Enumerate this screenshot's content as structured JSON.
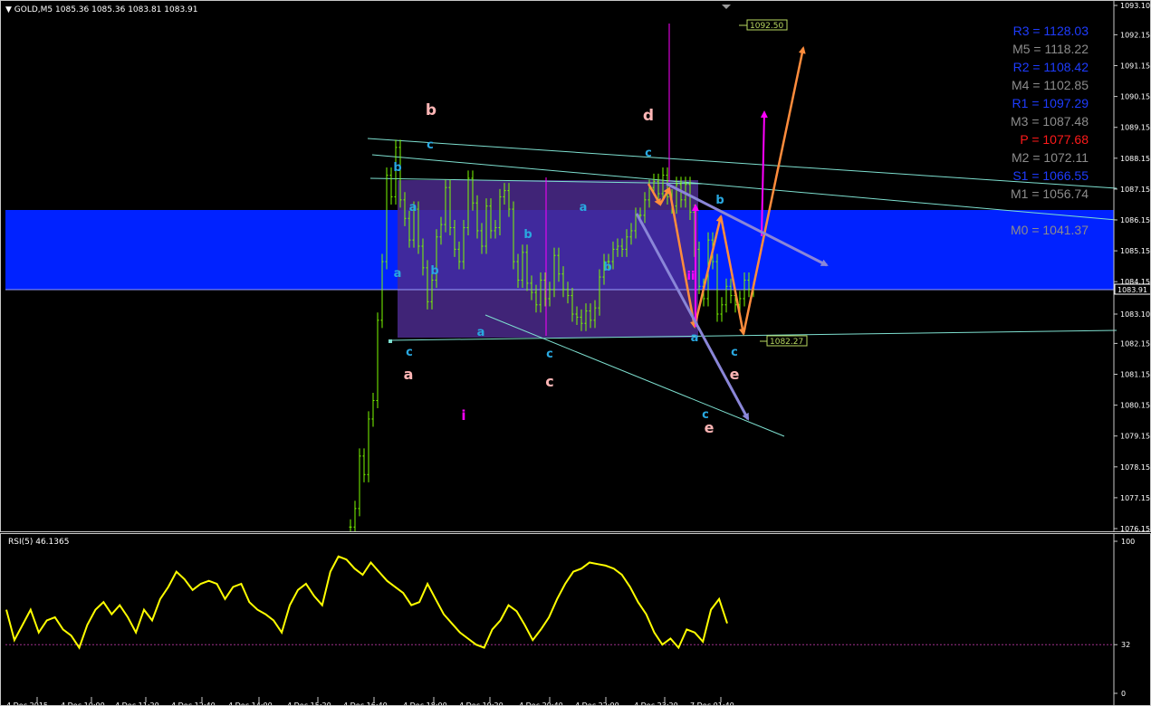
{
  "header": {
    "symbol": "GOLD,M5",
    "ohlc": "1085.36 1085.36 1083.81 1083.91",
    "rsi_label": "RSI(5) 46.1365"
  },
  "colors": {
    "candle": "#7cfc00",
    "zone": "#0022ff",
    "rect": "#4b2a8c",
    "rsi": "#ffff00",
    "wave_cyan": "#29a8e0",
    "wave_pink": "#ffb6b6",
    "magenta": "#ff00ff",
    "orange": "#ff8c3c",
    "lavender": "#8a86d8",
    "trend": "#7ee0d0"
  },
  "price_labels": {
    "upper_box": "1092.50",
    "lower_box": "1082.27",
    "current": "1083.91"
  },
  "pivots": [
    {
      "label": "R3 = 1128.03",
      "color": "#1e3cff"
    },
    {
      "label": "M5 = 1118.22",
      "color": "#8c8c8c"
    },
    {
      "label": "R2 = 1108.42",
      "color": "#1e3cff"
    },
    {
      "label": "M4 = 1102.85",
      "color": "#8c8c8c"
    },
    {
      "label": "R1 = 1097.29",
      "color": "#1e3cff"
    },
    {
      "label": "M3 = 1087.48",
      "color": "#8c8c8c"
    },
    {
      "label": "P   = 1077.68",
      "color": "#ff1a1a"
    },
    {
      "label": "M2 = 1072.11",
      "color": "#8c8c8c"
    },
    {
      "label": "S1 = 1066.55",
      "color": "#1e3cff"
    },
    {
      "label": "M1 = 1056.74",
      "color": "#8c8c8c"
    },
    {
      "label": "",
      "color": "#1e3cff"
    },
    {
      "label": "M0 = 1041.37",
      "color": "#8c8c8c"
    }
  ],
  "wave_labels": [
    {
      "t": "b",
      "c": "pink"
    },
    {
      "t": "c",
      "c": "cyan"
    },
    {
      "t": "b",
      "c": "cyan"
    },
    {
      "t": "a",
      "c": "cyan"
    },
    {
      "t": "a",
      "c": "cyan"
    },
    {
      "t": "b",
      "c": "cyan"
    },
    {
      "t": "c",
      "c": "cyan"
    },
    {
      "t": "a",
      "c": "pink"
    },
    {
      "t": "a",
      "c": "cyan"
    },
    {
      "t": "i",
      "c": "magenta"
    },
    {
      "t": "c",
      "c": "cyan"
    },
    {
      "t": "c",
      "c": "pink"
    },
    {
      "t": "b",
      "c": "cyan"
    },
    {
      "t": "a",
      "c": "cyan"
    },
    {
      "t": "b",
      "c": "cyan"
    },
    {
      "t": "d",
      "c": "pink"
    },
    {
      "t": "c",
      "c": "cyan"
    },
    {
      "t": "b",
      "c": "cyan"
    },
    {
      "t": "a",
      "c": "cyan"
    },
    {
      "t": "c",
      "c": "cyan"
    },
    {
      "t": "e",
      "c": "pink"
    },
    {
      "t": "c",
      "c": "cyan"
    },
    {
      "t": "e",
      "c": "pink"
    },
    {
      "t": "ii",
      "c": "magenta"
    }
  ],
  "chart_data": [
    {
      "type": "candlestick",
      "title": "GOLD,M5",
      "ylim": [
        1076.15,
        1093.1
      ],
      "y_ticks": [
        "1093.10",
        "1092.15",
        "1091.15",
        "1090.15",
        "1089.15",
        "1088.15",
        "1087.15",
        "1086.15",
        "1085.15",
        "1084.15",
        "1083.10",
        "1082.15",
        "1081.15",
        "1080.15",
        "1079.15",
        "1078.15",
        "1077.15",
        "1076.15"
      ],
      "x_ticks": [
        "4 Dec 2015",
        "4 Dec 10:00",
        "4 Dec 11:20",
        "4 Dec 12:40",
        "4 Dec 14:00",
        "4 Dec 15:20",
        "4 Dec 16:40",
        "4 Dec 18:00",
        "4 Dec 19:20",
        "4 Dec 20:40",
        "4 Dec 22:00",
        "4 Dec 23:20",
        "7 Dec 01:40"
      ],
      "series": [
        {
          "values": [
            1076.2,
            1076.8,
            1078.5,
            1077.9,
            1079.7,
            1080.3,
            1082.9,
            1084.8,
            1087.6,
            1086.9,
            1088.5,
            1086.8,
            1086.2,
            1085.5,
            1086.5,
            1085.3,
            1084.6,
            1083.5,
            1084.2,
            1085.6,
            1086.0,
            1087.2,
            1085.9,
            1085.2,
            1084.8,
            1085.9,
            1087.5,
            1086.7,
            1085.8,
            1085.3,
            1086.6,
            1085.8,
            1085.9,
            1086.9,
            1087.1,
            1086.5,
            1084.8,
            1084.2,
            1085.1,
            1084.1,
            1083.8,
            1083.4,
            1084.2,
            1083.6,
            1083.9,
            1085.0,
            1084.4,
            1083.9,
            1083.7,
            1083.1,
            1083.0,
            1082.8,
            1083.2,
            1082.9,
            1083.3,
            1084.3,
            1084.8,
            1084.8,
            1085.2,
            1085.3,
            1085.2,
            1085.6,
            1085.8,
            1086.3,
            1086.3,
            1086.8,
            1087.2,
            1087.4,
            1087.0,
            1087.6,
            1086.9,
            1086.6,
            1087.3,
            1086.8,
            1087.3,
            1086.4,
            1085.2,
            1084.0,
            1083.6,
            1085.5,
            1084.8,
            1083.1,
            1083.4,
            1084.0,
            1083.7,
            1083.4,
            1083.6,
            1084.2,
            1083.9,
            1083.9
          ]
        }
      ]
    },
    {
      "type": "line",
      "title": "RSI(5) 46.1365",
      "ylim": [
        0,
        100
      ],
      "y_ticks": [
        "100",
        "32",
        "0"
      ],
      "series": [
        {
          "name": "RSI(5) 46.1365",
          "values": [
            55,
            35,
            45,
            55,
            40,
            48,
            50,
            42,
            38,
            30,
            45,
            55,
            60,
            52,
            58,
            50,
            40,
            55,
            48,
            62,
            70,
            80,
            75,
            68,
            72,
            74,
            72,
            62,
            70,
            72,
            60,
            55,
            52,
            48,
            40,
            58,
            68,
            72,
            64,
            58,
            80,
            90,
            88,
            82,
            78,
            86,
            80,
            74,
            70,
            66,
            58,
            60,
            72,
            62,
            52,
            46,
            40,
            36,
            32,
            30,
            42,
            48,
            58,
            54,
            45,
            35,
            42,
            50,
            62,
            72,
            80,
            82,
            86,
            85,
            84,
            82,
            78,
            70,
            60,
            52,
            40,
            32,
            36,
            30,
            42,
            40,
            34,
            55,
            62,
            46
          ]
        }
      ]
    }
  ]
}
